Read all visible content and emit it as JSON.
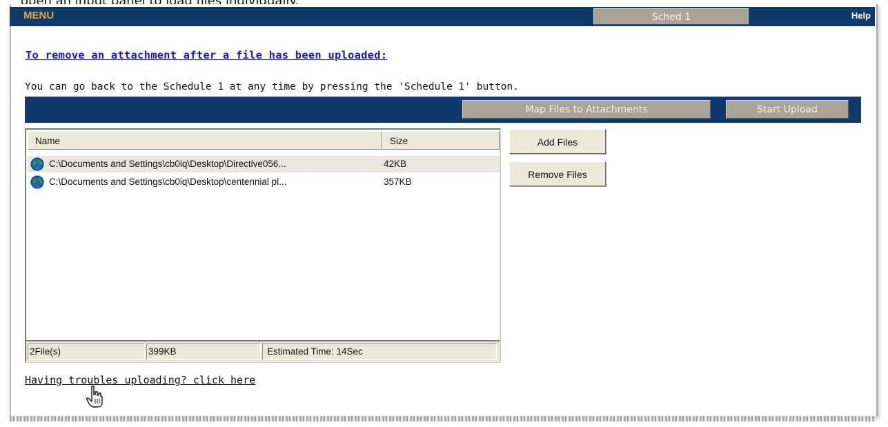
{
  "caption": "open an input panel to load files individually.",
  "menu_bar": {
    "menu_label": "MENU",
    "sched_button": "Sched 1",
    "help_link": "Help"
  },
  "heading": "To remove an attachment after a file has been uploaded:",
  "instruction": "You can go back to the Schedule 1 at any time by pressing the 'Schedule 1' button.",
  "toolbar": {
    "map_button": "Map Files to Attachments",
    "start_upload_button": "Start Upload"
  },
  "file_list": {
    "columns": [
      "Name",
      "Size"
    ],
    "rows": [
      {
        "name": "C:\\Documents and Settings\\cb0iq\\Desktop\\Directive056...",
        "size": "42KB",
        "icon": "globe-icon"
      },
      {
        "name": "C:\\Documents and Settings\\cb0iq\\Desktop\\centennial pl...",
        "size": "357KB",
        "icon": "globe-icon"
      }
    ],
    "status": {
      "count": "2File(s)",
      "total_size": "399KB",
      "estimated_time": "Estimated Time: 14Sec"
    }
  },
  "side_buttons": {
    "add_files": "Add Files",
    "remove_files": "Remove Files"
  },
  "troubles_link": "Having troubles uploading? click here",
  "colors": {
    "navy": "#0f3a6b",
    "menu_orange": "#e8a23a",
    "button_gray": "#a9a399",
    "link_blue": "#1a1acc",
    "panel_beige": "#ece9d8"
  }
}
